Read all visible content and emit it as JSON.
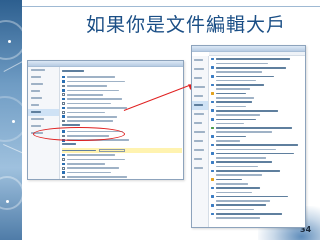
{
  "slide": {
    "title": "如果你是文件編輯大戶",
    "page_number": "34"
  }
}
